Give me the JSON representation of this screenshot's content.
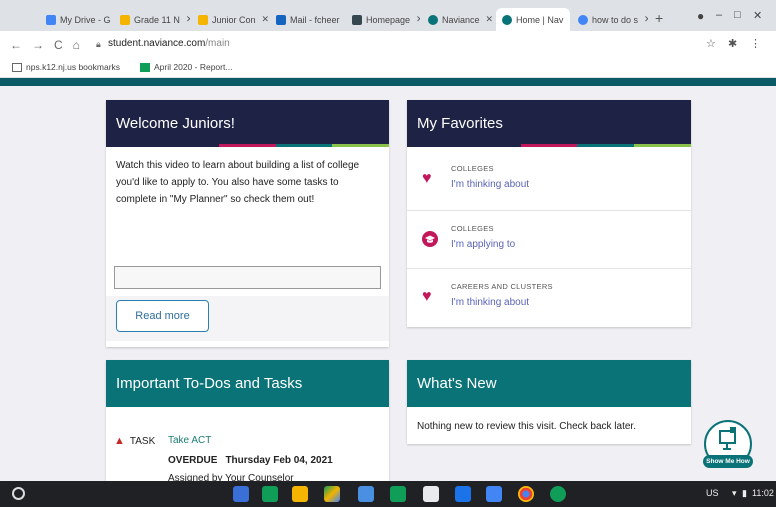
{
  "browser": {
    "tabs": [
      {
        "label": "My Drive - G",
        "color": "#4285f4"
      },
      {
        "label": "Grade 11 N",
        "color": "#f4b400"
      },
      {
        "label": "Junior Con",
        "color": "#f4b400"
      },
      {
        "label": "Mail - fcheer",
        "color": "#1565c0"
      },
      {
        "label": "Homepage",
        "color": "#37474f"
      },
      {
        "label": "Naviance",
        "color": "#0a7377"
      },
      {
        "label": "Home | Nav",
        "color": "#0a7377"
      },
      {
        "label": "how to do s",
        "color": "#4285f4"
      }
    ],
    "new_tab": "+",
    "url_host": "student.naviance.com",
    "url_path": "/main",
    "bookmarks": [
      {
        "label": "nps.k12.nj.us bookmarks",
        "icon": "folder-icon"
      },
      {
        "label": "April 2020 - Report...",
        "icon": "sheets-icon"
      }
    ]
  },
  "welcome": {
    "title": "Welcome Juniors!",
    "body": "Watch this video to learn about building a list of college you'd like to apply to. You also have some tasks to complete in \"My Planner\" so check them out!",
    "button": "Read more"
  },
  "favorites": {
    "title": "My Favorites",
    "items": [
      {
        "category": "COLLEGES",
        "link": "I'm thinking about",
        "icon": "heart-icon"
      },
      {
        "category": "COLLEGES",
        "link": "I'm applying to",
        "icon": "graduation-cap-icon"
      },
      {
        "category": "CAREERS AND CLUSTERS",
        "link": "I'm thinking about",
        "icon": "heart-icon"
      }
    ]
  },
  "todos": {
    "title": "Important To-Dos and Tasks",
    "task_label": "TASK",
    "task_name": "Take ACT",
    "status": "OVERDUE",
    "due": "Thursday Feb 04, 2021",
    "assigned": "Assigned by Your Counselor"
  },
  "whatsnew": {
    "title": "What's New",
    "body": "Nothing new to review this visit. Check back later."
  },
  "show_me_how": "Show Me How",
  "taskbar": {
    "locale": "US",
    "time": "11:02"
  },
  "colors": {
    "navy": "#1e2244",
    "teal": "#0a7377",
    "accent": "#c2185b"
  }
}
